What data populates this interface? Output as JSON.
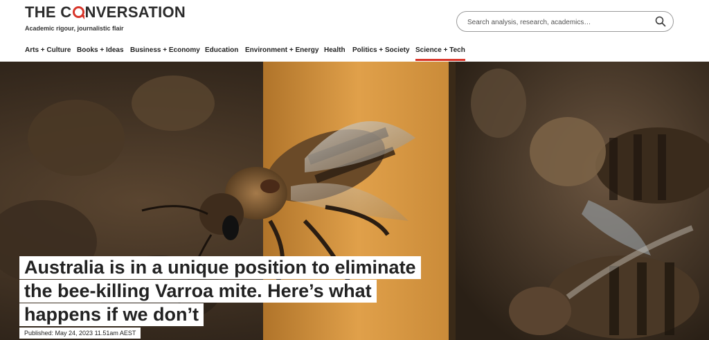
{
  "brand": {
    "logo_pre": "THE C",
    "logo_post": "NVERSATION",
    "tagline": "Academic rigour, journalistic flair"
  },
  "search": {
    "placeholder": "Search analysis, research, academics…",
    "icon": "search-icon"
  },
  "nav": {
    "items": [
      {
        "label": "Arts + Culture"
      },
      {
        "label": "Books + Ideas"
      },
      {
        "label": "Business + Economy"
      },
      {
        "label": "Education"
      },
      {
        "label": "Environment + Energy"
      },
      {
        "label": "Health"
      },
      {
        "label": "Politics + Society"
      },
      {
        "label": "Science + Tech",
        "active": true
      }
    ]
  },
  "article": {
    "headline_lines": [
      "Australia is in a unique position to eliminate",
      "the bee-killing Varroa mite. Here’s what",
      "happens if we don’t"
    ],
    "published": "Published: May 24, 2023 11.51am AEST"
  },
  "colors": {
    "accent": "#d8352a",
    "text": "#222222"
  }
}
